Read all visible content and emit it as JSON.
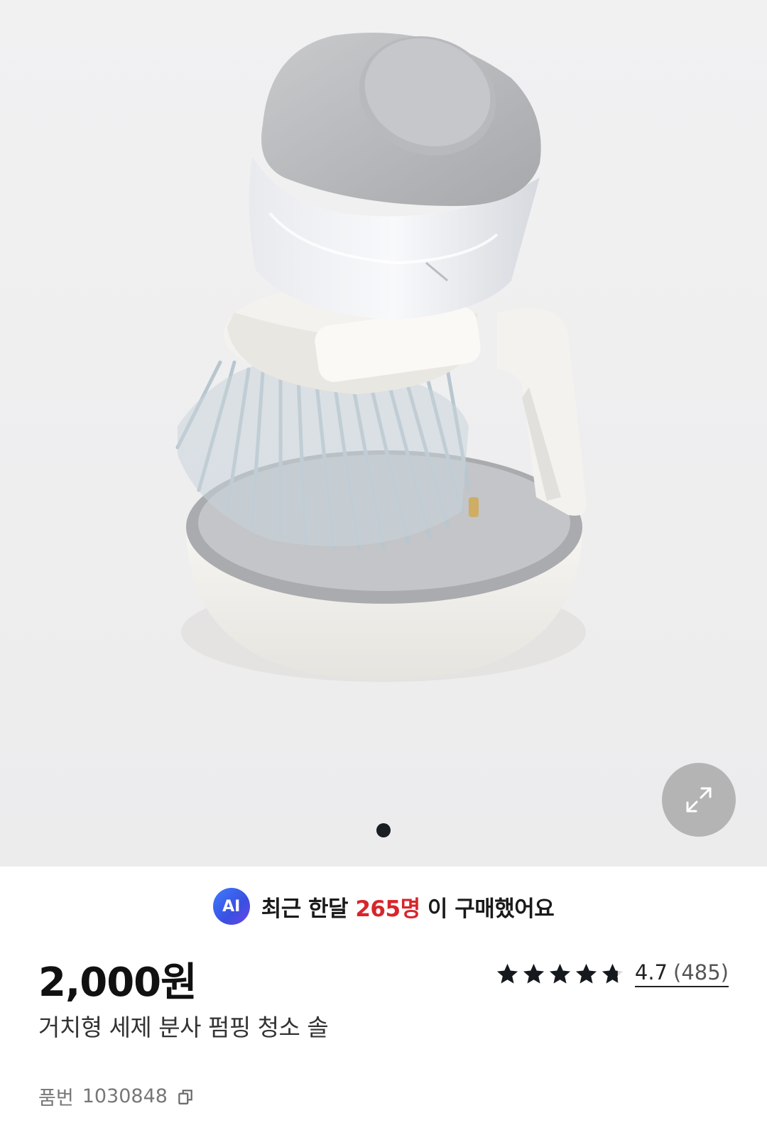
{
  "gallery": {
    "product_image_alt": "거치형 세제 분사 펌핑 청소 솔",
    "expand_icon": "expand-arrows-icon",
    "dot_count": 1,
    "active_dot": 0
  },
  "ai_banner": {
    "badge": "AI",
    "prefix": "최근 한달 ",
    "highlight": "265명",
    "suffix": " 이 구매했어요",
    "highlight_color": "#d7262b"
  },
  "product": {
    "price": "2,000원",
    "title": "거치형 세제 분사 펌핑 청소 솔",
    "sku_label": "품번",
    "sku_value": "1030848",
    "copy_icon": "copy-icon"
  },
  "rating": {
    "value": "4.7",
    "count": "(485)",
    "stars_filled": 4.7,
    "stars_total": 5
  }
}
